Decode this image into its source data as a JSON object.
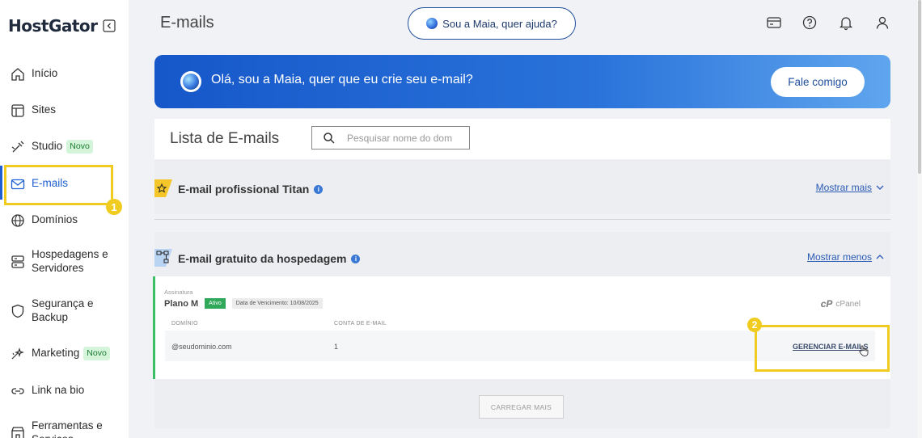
{
  "sidebar": {
    "logo": "HostGator",
    "items": [
      {
        "label": "Início",
        "icon": "home-icon"
      },
      {
        "label": "Sites",
        "icon": "layout-icon"
      },
      {
        "label": "Studio",
        "icon": "magic-wand-icon",
        "badge": "Novo"
      },
      {
        "label": "E-mails",
        "icon": "envelope-icon",
        "active": true
      },
      {
        "label": "Domínios",
        "icon": "globe-icon"
      },
      {
        "label": "Hospedagens e Servidores",
        "icon": "server-icon"
      },
      {
        "label": "Segurança e Backup",
        "icon": "shield-icon"
      },
      {
        "label": "Marketing",
        "icon": "sparkle-icon",
        "badge": "Novo"
      },
      {
        "label": "Link na bio",
        "icon": "link-icon"
      },
      {
        "label": "Ferramentas e Serviços",
        "icon": "store-icon"
      }
    ]
  },
  "annotations": {
    "step1": "1",
    "step2": "2",
    "highlight_color": "#f1cc20"
  },
  "header": {
    "title": "E-mails",
    "maia_button": "Sou a Maia, quer ajuda?",
    "icons": [
      "credit-card-icon",
      "help-icon",
      "bell-icon",
      "user-icon"
    ]
  },
  "banner": {
    "text": "Olá, sou a Maia, quer que eu crie seu e-mail?",
    "button": "Fale comigo"
  },
  "list": {
    "title": "Lista de E-mails",
    "search_placeholder": "Pesquisar nome do dom"
  },
  "sections": [
    {
      "title": "E-mail profissional Titan",
      "toggle": "Mostrar mais"
    },
    {
      "title": "E-mail gratuito da hospedagem",
      "toggle": "Mostrar menos"
    }
  ],
  "subscription": {
    "label": "Assinatura",
    "plan": "Plano M",
    "status": "Ativo",
    "due": "Data de Vencimento: 10/08/2025",
    "provider": "cPanel",
    "provider_logo": "cP",
    "columns": [
      "DOMÍNIO",
      "CONTA DE E-MAIL"
    ],
    "row": {
      "domain": "@seudominio.com",
      "accounts": "1",
      "action": "GERENCIAR E-MAILS"
    }
  },
  "load_more": "CARREGAR MAIS",
  "colors": {
    "brand_blue": "#1f5fd1",
    "active_green": "#2fa85a"
  }
}
